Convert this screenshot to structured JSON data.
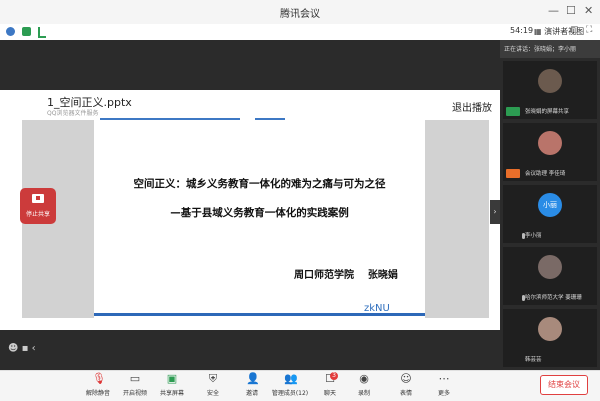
{
  "window": {
    "title": "腾讯会议"
  },
  "infobar": {
    "timer": "54:19",
    "view_mode": "演讲者视图"
  },
  "document": {
    "filename": "1_空间正义.pptx",
    "source": "QQ浏览器文件服务",
    "exit_label": "退出播放"
  },
  "slide": {
    "title_line1": "空间正义：城乡义务教育一体化的难为之痛与可为之径",
    "title_line2": "—基于县域义务教育一体化的实践案例",
    "author": "周口师范学院    张晓娟",
    "logo": "zkNU"
  },
  "share_overlay": {
    "label": "停止共享"
  },
  "participants": {
    "speaking_text": "正在讲话：张晓娟；李小丽",
    "tiles": [
      {
        "name": "张晓娟的屏幕共享"
      },
      {
        "name": "会议助理 李佳琦"
      },
      {
        "name": "李小丽",
        "avatar_text": "小丽"
      },
      {
        "name": "哈尔滨师范大学 姜珊珊"
      },
      {
        "name": "韩芸芸"
      }
    ]
  },
  "toolbar": {
    "items": [
      {
        "label": "解除静音",
        "icon": "mic-muted-icon"
      },
      {
        "label": "开启视频",
        "icon": "video-off-icon"
      },
      {
        "label": "共享屏幕",
        "icon": "share-screen-icon"
      },
      {
        "label": "安全",
        "icon": "shield-icon"
      },
      {
        "label": "邀请",
        "icon": "invite-icon"
      },
      {
        "label": "管理成员(12)",
        "icon": "members-icon"
      },
      {
        "label": "聊天",
        "icon": "chat-icon"
      },
      {
        "label": "录制",
        "icon": "record-icon"
      },
      {
        "label": "表情",
        "icon": "emoji-icon"
      },
      {
        "label": "更多",
        "icon": "more-icon"
      }
    ],
    "chat_badge": "3",
    "end_label": "结束会议"
  },
  "colors": {
    "accent": "#2d68b8",
    "danger": "#e04040",
    "share_red": "#cc3b3b",
    "stage_bg": "#2b2b2b"
  }
}
